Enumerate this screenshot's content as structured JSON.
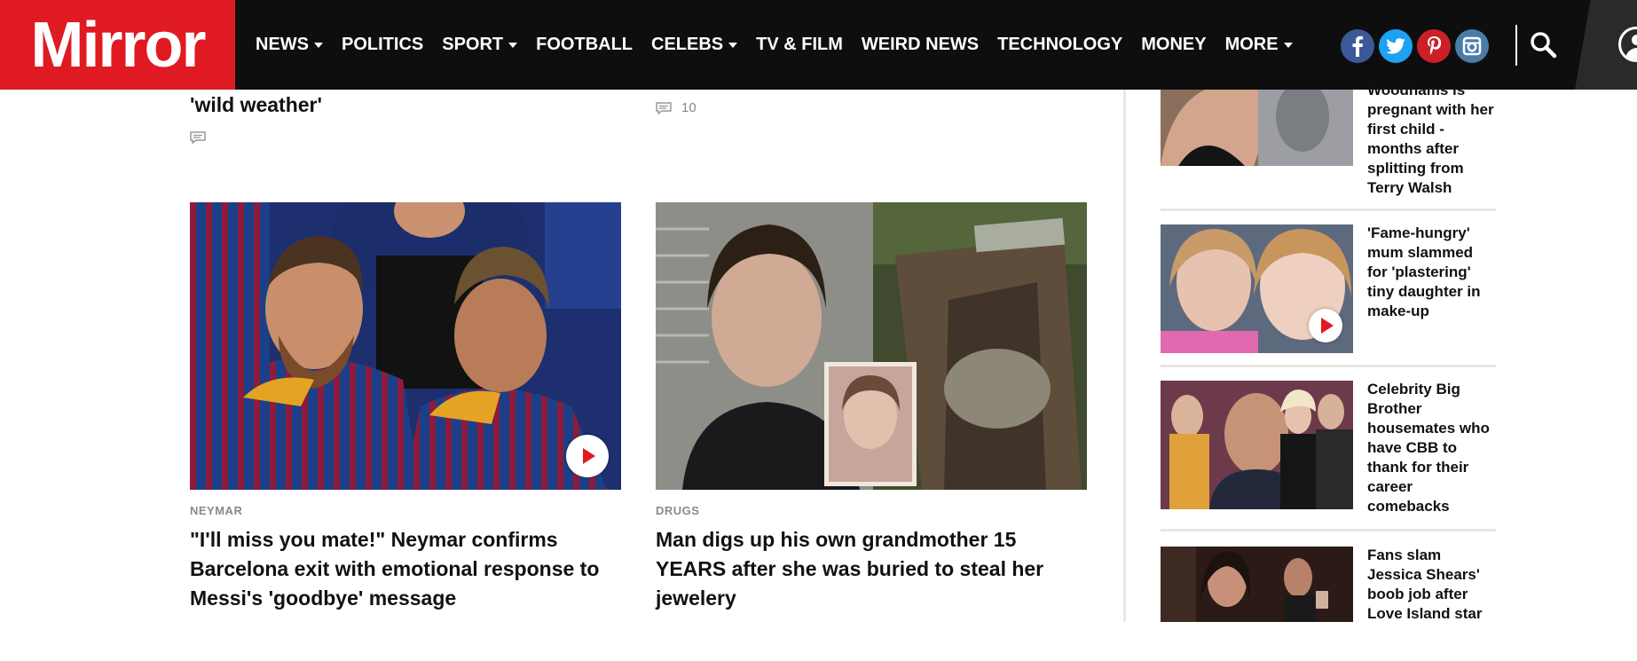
{
  "brand": {
    "logo": "Mirror",
    "accent": "#e01a22"
  },
  "nav": {
    "items": [
      {
        "label": "NEWS",
        "dropdown": true
      },
      {
        "label": "POLITICS",
        "dropdown": false
      },
      {
        "label": "SPORT",
        "dropdown": true
      },
      {
        "label": "FOOTBALL",
        "dropdown": false
      },
      {
        "label": "CELEBS",
        "dropdown": true
      },
      {
        "label": "TV & FILM",
        "dropdown": false
      },
      {
        "label": "WEIRD NEWS",
        "dropdown": false
      },
      {
        "label": "TECHNOLOGY",
        "dropdown": false
      },
      {
        "label": "MONEY",
        "dropdown": false
      },
      {
        "label": "MORE",
        "dropdown": true
      }
    ],
    "social": [
      {
        "name": "facebook-icon",
        "glyph": "f",
        "color": "#3b5998"
      },
      {
        "name": "twitter-icon",
        "glyph": "t",
        "color": "#1da1f2"
      },
      {
        "name": "pinterest-icon",
        "glyph": "p",
        "color": "#cb2027"
      },
      {
        "name": "instagram-icon",
        "glyph": "◙",
        "color": "#4a7ca8"
      }
    ]
  },
  "main": {
    "top_left_headline": "'wild weather'",
    "top_right_comments": "10",
    "cards": [
      {
        "kicker": "NEYMAR",
        "title": "\"I'll miss you mate!\" Neymar confirms Barcelona exit with emotional response to Messi's 'goodbye' message",
        "has_video": true
      },
      {
        "kicker": "DRUGS",
        "title": "Man digs up his own grandmother 15 YEARS after she was buried to steal her jewelery",
        "has_video": false
      }
    ]
  },
  "sidebar": {
    "items": [
      {
        "title": "Woodhams is pregnant with her first child - months after splitting from Terry Walsh",
        "has_video": false
      },
      {
        "title": "'Fame-hungry' mum slammed for 'plastering' tiny daughter in make-up",
        "has_video": true
      },
      {
        "title": "Celebrity Big Brother housemates who have CBB to thank for their career comebacks",
        "has_video": false
      },
      {
        "title": "Fans slam Jessica Shears' boob job after Love Island star",
        "has_video": false
      }
    ]
  }
}
